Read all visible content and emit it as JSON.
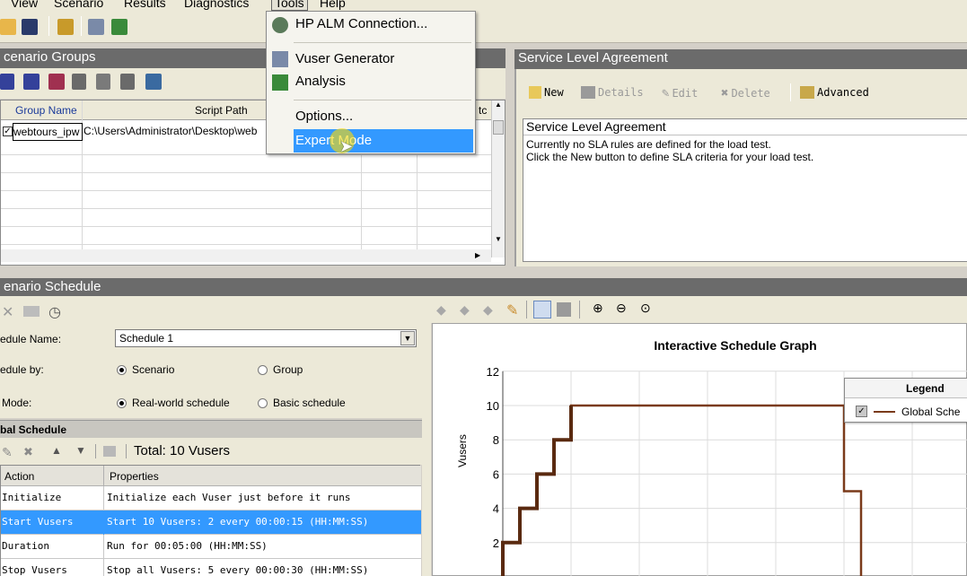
{
  "menubar": {
    "items": [
      "View",
      "Scenario",
      "Results",
      "Diagnostics",
      "Tools",
      "Help"
    ]
  },
  "tools_menu": {
    "items": [
      {
        "label": "HP ALM Connection..."
      },
      {
        "label": "Vuser Generator"
      },
      {
        "label": "Analysis"
      },
      {
        "label": "Options..."
      },
      {
        "label": "Expert Mode"
      }
    ]
  },
  "scenario_groups": {
    "title": "cenario Groups",
    "columns": [
      "Group Name",
      "Script Path",
      "tc"
    ],
    "row": {
      "group_name": "webtours_ipw",
      "script_path": "C:\\Users\\Administrator\\Desktop\\web"
    }
  },
  "sla": {
    "title": "Service Level Agreement",
    "buttons": {
      "new": "New",
      "details": "Details",
      "edit": "Edit",
      "delete": "Delete",
      "advanced": "Advanced"
    },
    "box_title": "Service Level Agreement",
    "line1": "Currently no SLA rules are defined for the load test.",
    "line2": "Click the New button to define SLA criteria for your load test."
  },
  "scenario_schedule": {
    "title": "enario Schedule",
    "schedule_name_label": "edule Name:",
    "schedule_name_value": "Schedule 1",
    "schedule_by_label": "edule by:",
    "schedule_by_options": [
      "Scenario",
      "Group"
    ],
    "mode_label": "Mode:",
    "mode_options": [
      "Real-world schedule",
      "Basic schedule"
    ]
  },
  "global_schedule": {
    "title": "bal Schedule",
    "total": "Total: 10 Vusers",
    "columns": [
      "Action",
      "Properties"
    ],
    "rows": [
      {
        "action": "Initialize",
        "properties": "Initialize each Vuser just before it runs"
      },
      {
        "action": "Start  Vusers",
        "properties": "Start 10 Vusers: 2 every 00:00:15 (HH:MM:SS)"
      },
      {
        "action": "Duration",
        "properties": "Run for 00:05:00 (HH:MM:SS)"
      },
      {
        "action": "Stop Vusers",
        "properties": "Stop all Vusers: 5 every 00:00:30 (HH:MM:SS)"
      }
    ]
  },
  "graph": {
    "title": "Interactive Schedule Graph",
    "ylabel": "Vusers",
    "legend_title": "Legend",
    "legend_item": "Global Sche"
  },
  "colors": {
    "series": "#7a3a1a",
    "selection": "#3399ff",
    "panel_header": "#6b6b6b"
  },
  "chart_data": {
    "type": "line",
    "title": "Interactive Schedule Graph",
    "xlabel": "",
    "ylabel": "Vusers",
    "yticks": [
      2,
      4,
      6,
      8,
      10,
      12
    ],
    "ylim": [
      0,
      12
    ],
    "series": [
      {
        "name": "Global Sche",
        "x": [
          0,
          0,
          1,
          1,
          2,
          2,
          3,
          3,
          4,
          4,
          20,
          20,
          21,
          21
        ],
        "y": [
          0,
          2,
          2,
          4,
          4,
          6,
          6,
          8,
          8,
          10,
          10,
          5,
          5,
          0
        ]
      }
    ]
  }
}
